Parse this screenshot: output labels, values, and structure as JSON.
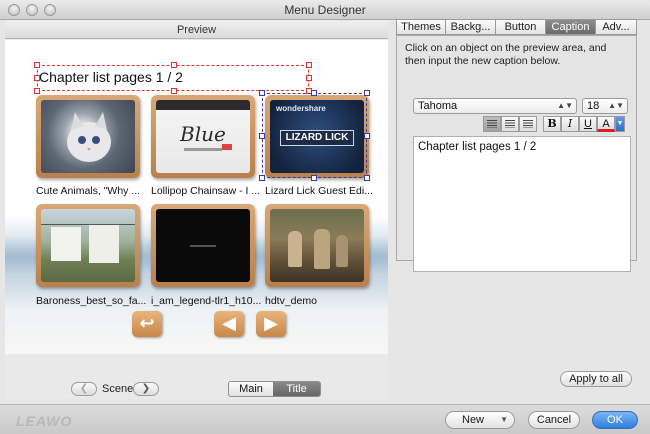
{
  "window": {
    "title": "Menu Designer"
  },
  "preview": {
    "header": "Preview",
    "chapter_title": "Chapter list pages 1 / 2",
    "chapters": [
      {
        "label": "Cute Animals, \"Why ...",
        "thumb": "kitten"
      },
      {
        "label": "Lollipop Chainsaw - I ...",
        "thumb": "blue",
        "thumb_text": "Blue"
      },
      {
        "label": "Lizard Lick Guest Edi...",
        "thumb": "lizard",
        "thumb_brand": "wondershare",
        "thumb_text": "LIZARD LICK"
      },
      {
        "label": "Baroness_best_so_fa...",
        "thumb": "laundry"
      },
      {
        "label": "i_am_legend-tlr1_h10...",
        "thumb": "dark"
      },
      {
        "label": "hdtv_demo",
        "thumb": "soldiers"
      }
    ],
    "nav_buttons": {
      "back_icon": "return-arrow-icon",
      "prev_icon": "left-arrow-icon",
      "next_icon": "right-arrow-icon"
    },
    "scene_label": "Scene",
    "segments": {
      "main": "Main",
      "title": "Title",
      "selected": "Title"
    }
  },
  "tabs": [
    {
      "label": "Themes",
      "active": false
    },
    {
      "label": "Backg...",
      "active": false
    },
    {
      "label": "Button",
      "active": false
    },
    {
      "label": "Caption",
      "active": true
    },
    {
      "label": "Adv...",
      "active": false
    }
  ],
  "caption": {
    "instructions": "Click on an object on the preview area, and then input the new caption below.",
    "font": "Tahoma",
    "size": "18",
    "format_buttons": {
      "bold": "B",
      "italic": "I",
      "underline": "U",
      "color": "A"
    },
    "text": "Chapter list pages 1 / 2",
    "apply_all": "Apply to all",
    "color_underline": "#d42020"
  },
  "footer": {
    "logo": "LEAWO",
    "new": "New",
    "cancel": "Cancel",
    "ok": "OK"
  }
}
